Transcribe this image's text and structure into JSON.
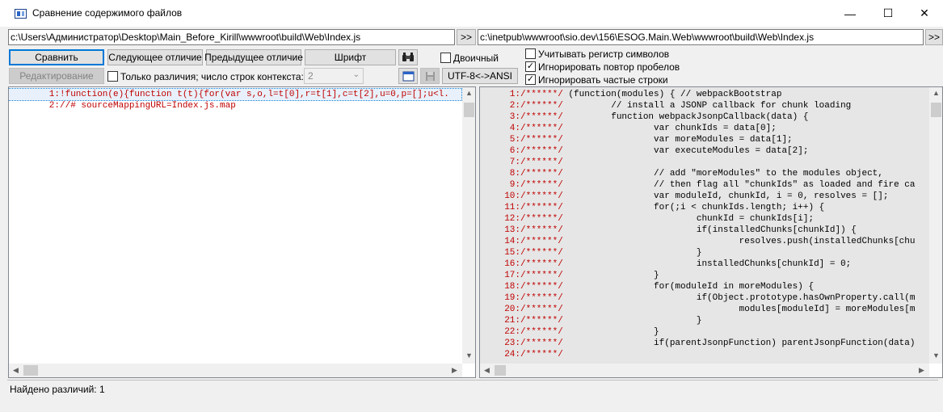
{
  "window": {
    "title": "Сравнение содержимого файлов",
    "minimize": "—",
    "maximize": "☐",
    "close": "✕"
  },
  "left_path": "c:\\Users\\Администратор\\Desktop\\Main_Before_Kirill\\wwwroot\\build\\Web\\Index.js",
  "right_path": "c:\\inetpub\\wwwroot\\sio.dev\\156\\ESOG.Main.Web\\wwwroot\\build\\Web\\Index.js",
  "browse_label": ">>",
  "buttons": {
    "compare": "Сравнить",
    "next_diff": "Следующее отличие",
    "prev_diff": "Предыдущее отличие",
    "font": "Шрифт",
    "edit": "Редактирование",
    "encoding": "UTF-8<->ANSI"
  },
  "options": {
    "binary": "Двоичный",
    "case": "Учитывать регистр символов",
    "ignore_spaces": "Игнорировать повтор пробелов",
    "ignore_frequent": "Игнорировать частые строки",
    "only_diffs": "Только различия; число строк контекста:",
    "context_value": "2",
    "check_mark": "✓"
  },
  "left_lines": [
    {
      "num": "1:",
      "text": "!function(e){function t(t){for(var s,o,l=t[0],r=t[1],c=t[2],u=0,p=[];u<l."
    },
    {
      "num": "2:",
      "text": "//# sourceMappingURL=Index.js.map"
    }
  ],
  "right_lines": [
    {
      "num": "1:",
      "text": "/******/ (function(modules) { // webpackBootstrap"
    },
    {
      "num": "2:",
      "text": "/******/ \t// install a JSONP callback for chunk loading"
    },
    {
      "num": "3:",
      "text": "/******/ \tfunction webpackJsonpCallback(data) {"
    },
    {
      "num": "4:",
      "text": "/******/ \t\tvar chunkIds = data[0];"
    },
    {
      "num": "5:",
      "text": "/******/ \t\tvar moreModules = data[1];"
    },
    {
      "num": "6:",
      "text": "/******/ \t\tvar executeModules = data[2];"
    },
    {
      "num": "7:",
      "text": "/******/"
    },
    {
      "num": "8:",
      "text": "/******/ \t\t// add \"moreModules\" to the modules object,"
    },
    {
      "num": "9:",
      "text": "/******/ \t\t// then flag all \"chunkIds\" as loaded and fire ca"
    },
    {
      "num": "10:",
      "text": "/******/ \t\tvar moduleId, chunkId, i = 0, resolves = [];"
    },
    {
      "num": "11:",
      "text": "/******/ \t\tfor(;i < chunkIds.length; i++) {"
    },
    {
      "num": "12:",
      "text": "/******/ \t\t\tchunkId = chunkIds[i];"
    },
    {
      "num": "13:",
      "text": "/******/ \t\t\tif(installedChunks[chunkId]) {"
    },
    {
      "num": "14:",
      "text": "/******/ \t\t\t\tresolves.push(installedChunks[chu"
    },
    {
      "num": "15:",
      "text": "/******/ \t\t\t}"
    },
    {
      "num": "16:",
      "text": "/******/ \t\t\tinstalledChunks[chunkId] = 0;"
    },
    {
      "num": "17:",
      "text": "/******/ \t\t}"
    },
    {
      "num": "18:",
      "text": "/******/ \t\tfor(moduleId in moreModules) {"
    },
    {
      "num": "19:",
      "text": "/******/ \t\t\tif(Object.prototype.hasOwnProperty.call(m"
    },
    {
      "num": "20:",
      "text": "/******/ \t\t\t\tmodules[moduleId] = moreModules[m"
    },
    {
      "num": "21:",
      "text": "/******/ \t\t\t}"
    },
    {
      "num": "22:",
      "text": "/******/ \t\t}"
    },
    {
      "num": "23:",
      "text": "/******/ \t\tif(parentJsonpFunction) parentJsonpFunction(data)"
    },
    {
      "num": "24:",
      "text": "/******/"
    }
  ],
  "status": "Найдено различий: 1",
  "colors": {
    "diff_text": "#c00000",
    "accent": "#0078d7",
    "right_bg": "#e6e6e6"
  }
}
